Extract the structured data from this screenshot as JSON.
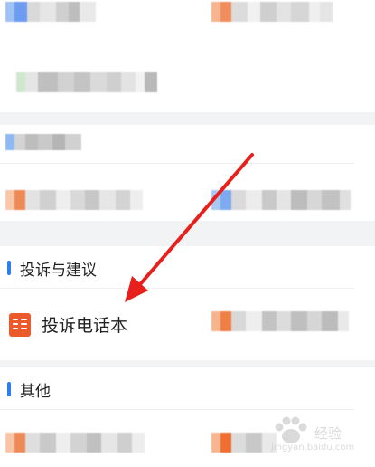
{
  "sections": {
    "complaint": {
      "title": "投诉与建议"
    },
    "other": {
      "title": "其他"
    }
  },
  "items": {
    "complaint_phonebook": {
      "label": "投诉电话本",
      "icon": "phonebook-icon"
    }
  },
  "colors": {
    "accent_blue": "#2f7df6",
    "icon_orange": "#ea5a2a",
    "arrow_red": "#e8201c"
  },
  "watermark": {
    "title": "经验",
    "subtitle": "jingyan.baidu.com"
  }
}
